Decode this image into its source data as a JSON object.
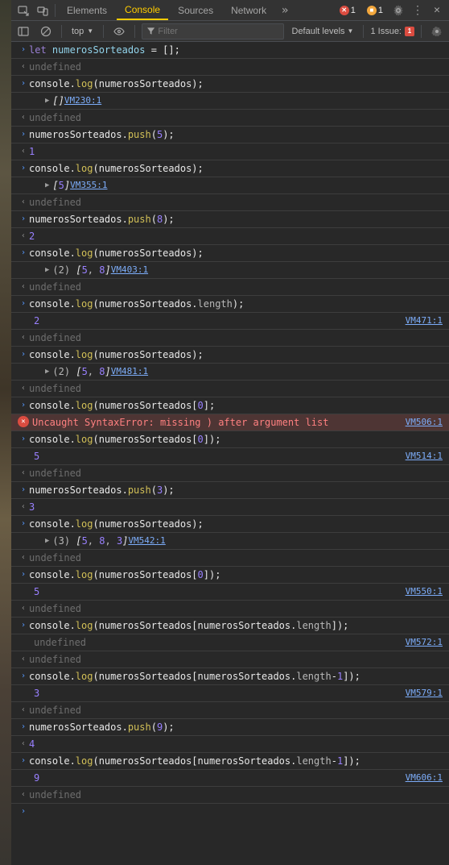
{
  "tabs": {
    "elements": "Elements",
    "console": "Console",
    "sources": "Sources",
    "network": "Network"
  },
  "errors": {
    "red": "1",
    "yellow": "1"
  },
  "toolbar": {
    "context": "top",
    "filter_placeholder": "Filter",
    "levels": "Default levels",
    "issues_label": "1 Issue:",
    "issues_count": "1"
  },
  "log": [
    {
      "t": "in",
      "seg": [
        {
          "c": "kw",
          "v": "let "
        },
        {
          "c": "var",
          "v": "numerosSorteados"
        },
        {
          "c": "",
          "v": " = [];"
        }
      ]
    },
    {
      "t": "out",
      "seg": [
        {
          "c": "undef",
          "v": "undefined"
        }
      ]
    },
    {
      "t": "in",
      "seg": [
        {
          "c": "",
          "v": "console."
        },
        {
          "c": "fn",
          "v": "log"
        },
        {
          "c": "",
          "v": "(numerosSorteados);"
        }
      ]
    },
    {
      "t": "sub",
      "src": "VM230:1",
      "seg": [
        {
          "c": "obj",
          "v": "[]"
        }
      ]
    },
    {
      "t": "out",
      "seg": [
        {
          "c": "undef",
          "v": "undefined"
        }
      ]
    },
    {
      "t": "in",
      "seg": [
        {
          "c": "",
          "v": "numerosSorteados."
        },
        {
          "c": "fn",
          "v": "push"
        },
        {
          "c": "",
          "v": "("
        },
        {
          "c": "num",
          "v": "5"
        },
        {
          "c": "",
          "v": ");"
        }
      ]
    },
    {
      "t": "out",
      "seg": [
        {
          "c": "num",
          "v": "1"
        }
      ]
    },
    {
      "t": "in",
      "seg": [
        {
          "c": "",
          "v": "console."
        },
        {
          "c": "fn",
          "v": "log"
        },
        {
          "c": "",
          "v": "(numerosSorteados);"
        }
      ]
    },
    {
      "t": "sub",
      "src": "VM355:1",
      "seg": [
        {
          "c": "obj",
          "v": "["
        },
        {
          "c": "num",
          "v": "5"
        },
        {
          "c": "obj",
          "v": "]"
        }
      ]
    },
    {
      "t": "out",
      "seg": [
        {
          "c": "undef",
          "v": "undefined"
        }
      ]
    },
    {
      "t": "in",
      "seg": [
        {
          "c": "",
          "v": "numerosSorteados."
        },
        {
          "c": "fn",
          "v": "push"
        },
        {
          "c": "",
          "v": "("
        },
        {
          "c": "num",
          "v": "8"
        },
        {
          "c": "",
          "v": ");"
        }
      ]
    },
    {
      "t": "out",
      "seg": [
        {
          "c": "num",
          "v": "2"
        }
      ]
    },
    {
      "t": "in",
      "seg": [
        {
          "c": "",
          "v": "console."
        },
        {
          "c": "fn",
          "v": "log"
        },
        {
          "c": "",
          "v": "(numerosSorteados);"
        }
      ]
    },
    {
      "t": "sub",
      "src": "VM403:1",
      "seg": [
        {
          "c": "prop",
          "v": "(2) "
        },
        {
          "c": "obj",
          "v": "["
        },
        {
          "c": "num",
          "v": "5"
        },
        {
          "c": "prop",
          "v": ", "
        },
        {
          "c": "num",
          "v": "8"
        },
        {
          "c": "obj",
          "v": "]"
        }
      ]
    },
    {
      "t": "out",
      "seg": [
        {
          "c": "undef",
          "v": "undefined"
        }
      ]
    },
    {
      "t": "in",
      "seg": [
        {
          "c": "",
          "v": "console."
        },
        {
          "c": "fn",
          "v": "log"
        },
        {
          "c": "",
          "v": "(numerosSorteados."
        },
        {
          "c": "prop",
          "v": "length"
        },
        {
          "c": "",
          "v": ");"
        }
      ]
    },
    {
      "t": "plain",
      "src": "VM471:1",
      "seg": [
        {
          "c": "num",
          "v": "2"
        }
      ]
    },
    {
      "t": "out",
      "seg": [
        {
          "c": "undef",
          "v": "undefined"
        }
      ]
    },
    {
      "t": "in",
      "seg": [
        {
          "c": "",
          "v": "console."
        },
        {
          "c": "fn",
          "v": "log"
        },
        {
          "c": "",
          "v": "(numerosSorteados);"
        }
      ]
    },
    {
      "t": "sub",
      "src": "VM481:1",
      "seg": [
        {
          "c": "prop",
          "v": "(2) "
        },
        {
          "c": "obj",
          "v": "["
        },
        {
          "c": "num",
          "v": "5"
        },
        {
          "c": "prop",
          "v": ", "
        },
        {
          "c": "num",
          "v": "8"
        },
        {
          "c": "obj",
          "v": "]"
        }
      ]
    },
    {
      "t": "out",
      "seg": [
        {
          "c": "undef",
          "v": "undefined"
        }
      ]
    },
    {
      "t": "in",
      "seg": [
        {
          "c": "",
          "v": "console."
        },
        {
          "c": "fn",
          "v": "log"
        },
        {
          "c": "",
          "v": "(numerosSorteados["
        },
        {
          "c": "num",
          "v": "0"
        },
        {
          "c": "",
          "v": "];"
        }
      ]
    },
    {
      "t": "err",
      "src": "VM506:1",
      "text": "Uncaught SyntaxError: missing ) after argument list"
    },
    {
      "t": "in",
      "seg": [
        {
          "c": "",
          "v": "console."
        },
        {
          "c": "fn",
          "v": "log"
        },
        {
          "c": "",
          "v": "(numerosSorteados["
        },
        {
          "c": "num",
          "v": "0"
        },
        {
          "c": "",
          "v": "]);"
        }
      ]
    },
    {
      "t": "plain",
      "src": "VM514:1",
      "seg": [
        {
          "c": "num",
          "v": "5"
        }
      ]
    },
    {
      "t": "out",
      "seg": [
        {
          "c": "undef",
          "v": "undefined"
        }
      ]
    },
    {
      "t": "in",
      "seg": [
        {
          "c": "",
          "v": "numerosSorteados."
        },
        {
          "c": "fn",
          "v": "push"
        },
        {
          "c": "",
          "v": "("
        },
        {
          "c": "num",
          "v": "3"
        },
        {
          "c": "",
          "v": ");"
        }
      ]
    },
    {
      "t": "out",
      "seg": [
        {
          "c": "num",
          "v": "3"
        }
      ]
    },
    {
      "t": "in",
      "seg": [
        {
          "c": "",
          "v": "console."
        },
        {
          "c": "fn",
          "v": "log"
        },
        {
          "c": "",
          "v": "(numerosSorteados);"
        }
      ]
    },
    {
      "t": "sub",
      "src": "VM542:1",
      "seg": [
        {
          "c": "prop",
          "v": "(3) "
        },
        {
          "c": "obj",
          "v": "["
        },
        {
          "c": "num",
          "v": "5"
        },
        {
          "c": "prop",
          "v": ", "
        },
        {
          "c": "num",
          "v": "8"
        },
        {
          "c": "prop",
          "v": ", "
        },
        {
          "c": "num",
          "v": "3"
        },
        {
          "c": "obj",
          "v": "]"
        }
      ]
    },
    {
      "t": "out",
      "seg": [
        {
          "c": "undef",
          "v": "undefined"
        }
      ]
    },
    {
      "t": "in",
      "seg": [
        {
          "c": "",
          "v": "console."
        },
        {
          "c": "fn",
          "v": "log"
        },
        {
          "c": "",
          "v": "(numerosSorteados["
        },
        {
          "c": "num",
          "v": "0"
        },
        {
          "c": "",
          "v": "]);"
        }
      ]
    },
    {
      "t": "plain",
      "src": "VM550:1",
      "seg": [
        {
          "c": "num",
          "v": "5"
        }
      ]
    },
    {
      "t": "out",
      "seg": [
        {
          "c": "undef",
          "v": "undefined"
        }
      ]
    },
    {
      "t": "in",
      "seg": [
        {
          "c": "",
          "v": "console."
        },
        {
          "c": "fn",
          "v": "log"
        },
        {
          "c": "",
          "v": "(numerosSorteados[numerosSorteados."
        },
        {
          "c": "prop",
          "v": "length"
        },
        {
          "c": "",
          "v": "]);"
        }
      ]
    },
    {
      "t": "plain",
      "src": "VM572:1",
      "seg": [
        {
          "c": "undef",
          "v": "undefined"
        }
      ]
    },
    {
      "t": "out",
      "seg": [
        {
          "c": "undef",
          "v": "undefined"
        }
      ]
    },
    {
      "t": "in",
      "seg": [
        {
          "c": "",
          "v": "console."
        },
        {
          "c": "fn",
          "v": "log"
        },
        {
          "c": "",
          "v": "(numerosSorteados[numerosSorteados."
        },
        {
          "c": "prop",
          "v": "length"
        },
        {
          "c": "",
          "v": "-"
        },
        {
          "c": "num",
          "v": "1"
        },
        {
          "c": "",
          "v": "]);"
        }
      ]
    },
    {
      "t": "plain",
      "src": "VM579:1",
      "seg": [
        {
          "c": "num",
          "v": "3"
        }
      ]
    },
    {
      "t": "out",
      "seg": [
        {
          "c": "undef",
          "v": "undefined"
        }
      ]
    },
    {
      "t": "in",
      "seg": [
        {
          "c": "",
          "v": "numerosSorteados."
        },
        {
          "c": "fn",
          "v": "push"
        },
        {
          "c": "",
          "v": "("
        },
        {
          "c": "num",
          "v": "9"
        },
        {
          "c": "",
          "v": ");"
        }
      ]
    },
    {
      "t": "out",
      "seg": [
        {
          "c": "num",
          "v": "4"
        }
      ]
    },
    {
      "t": "in",
      "seg": [
        {
          "c": "",
          "v": "console."
        },
        {
          "c": "fn",
          "v": "log"
        },
        {
          "c": "",
          "v": "(numerosSorteados[numerosSorteados."
        },
        {
          "c": "prop",
          "v": "length"
        },
        {
          "c": "",
          "v": "-"
        },
        {
          "c": "num",
          "v": "1"
        },
        {
          "c": "",
          "v": "]);"
        }
      ]
    },
    {
      "t": "plain",
      "src": "VM606:1",
      "seg": [
        {
          "c": "num",
          "v": "9"
        }
      ]
    },
    {
      "t": "out",
      "seg": [
        {
          "c": "undef",
          "v": "undefined"
        }
      ]
    },
    {
      "t": "prompt"
    }
  ]
}
